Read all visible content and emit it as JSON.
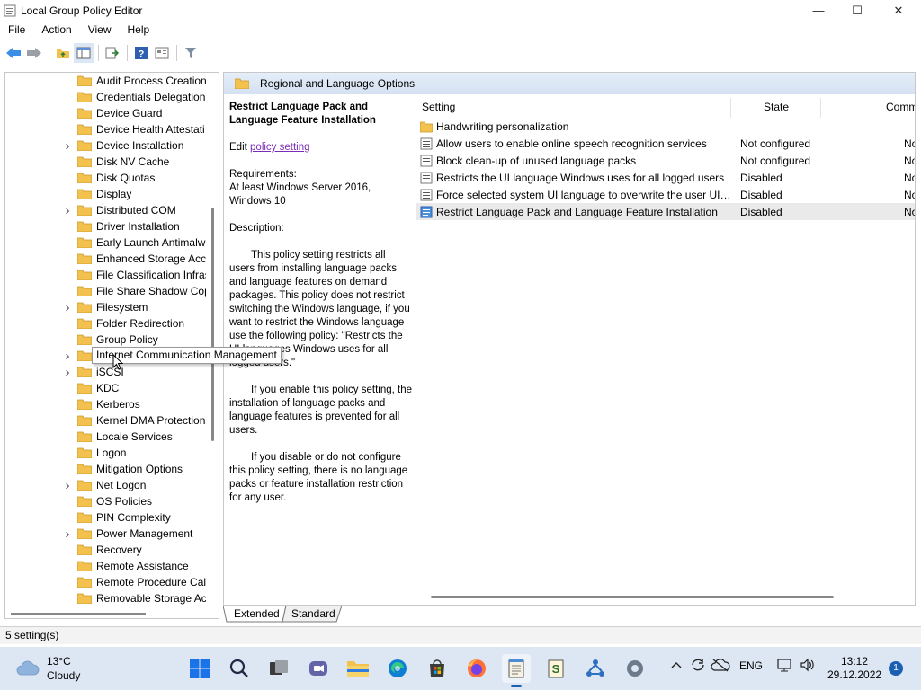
{
  "window": {
    "title": "Local Group Policy Editor",
    "controls": {
      "minimize": "—",
      "maximize": "☐",
      "close": "✕"
    }
  },
  "menu": [
    "File",
    "Action",
    "View",
    "Help"
  ],
  "tree": {
    "items": [
      {
        "label": "Audit Process Creation",
        "expandable": false
      },
      {
        "label": "Credentials Delegation",
        "expandable": false
      },
      {
        "label": "Device Guard",
        "expandable": false
      },
      {
        "label": "Device Health Attestati",
        "expandable": false
      },
      {
        "label": "Device Installation",
        "expandable": true
      },
      {
        "label": "Disk NV Cache",
        "expandable": false
      },
      {
        "label": "Disk Quotas",
        "expandable": false
      },
      {
        "label": "Display",
        "expandable": false
      },
      {
        "label": "Distributed COM",
        "expandable": true
      },
      {
        "label": "Driver Installation",
        "expandable": false
      },
      {
        "label": "Early Launch Antimalw",
        "expandable": false
      },
      {
        "label": "Enhanced Storage Acce",
        "expandable": false
      },
      {
        "label": "File Classification Infras",
        "expandable": false
      },
      {
        "label": "File Share Shadow Cop",
        "expandable": false
      },
      {
        "label": "Filesystem",
        "expandable": true
      },
      {
        "label": "Folder Redirection",
        "expandable": false
      },
      {
        "label": "Group Policy",
        "expandable": false
      },
      {
        "label": "Internet Communication Management",
        "expandable": true
      },
      {
        "label": "iSCSI",
        "expandable": true
      },
      {
        "label": "KDC",
        "expandable": false
      },
      {
        "label": "Kerberos",
        "expandable": false
      },
      {
        "label": "Kernel DMA Protection",
        "expandable": false
      },
      {
        "label": "Locale Services",
        "expandable": false
      },
      {
        "label": "Logon",
        "expandable": false
      },
      {
        "label": "Mitigation Options",
        "expandable": false
      },
      {
        "label": "Net Logon",
        "expandable": true
      },
      {
        "label": "OS Policies",
        "expandable": false
      },
      {
        "label": "PIN Complexity",
        "expandable": false
      },
      {
        "label": "Power Management",
        "expandable": true
      },
      {
        "label": "Recovery",
        "expandable": false
      },
      {
        "label": "Remote Assistance",
        "expandable": false
      },
      {
        "label": "Remote Procedure Call",
        "expandable": false
      },
      {
        "label": "Removable Storage Ac",
        "expandable": false
      }
    ],
    "tooltip": "Internet Communication Management"
  },
  "details": {
    "header": "Regional and Language Options",
    "title": "Restrict Language Pack and Language Feature Installation",
    "edit_prefix": "Edit",
    "edit_link": "policy setting",
    "requirements_label": "Requirements:",
    "requirements": "At least Windows Server 2016, Windows 10",
    "description_label": "Description:",
    "description_p1": "This policy setting restricts all users from installing language packs and language features on demand packages. This policy does not restrict switching the Windows language, if you want to restrict the Windows language use the following policy: \"Restricts the UI languages Windows uses for all logged users.\"",
    "description_p2": "If you enable this policy setting, the installation of language packs and language features is prevented for all users.",
    "description_p3": "If you disable or do not configure this policy setting, there is no language packs or feature installation restriction for any user."
  },
  "list": {
    "columns": {
      "setting": "Setting",
      "state": "State",
      "comment": "Comm"
    },
    "rows": [
      {
        "name": "Handwriting personalization",
        "state": "",
        "comment": "",
        "type": "folder"
      },
      {
        "name": "Allow users to enable online speech recognition services",
        "state": "Not configured",
        "comment": "No",
        "type": "setting"
      },
      {
        "name": "Block clean-up of unused language packs",
        "state": "Not configured",
        "comment": "No",
        "type": "setting"
      },
      {
        "name": "Restricts the UI language Windows uses for all logged users",
        "state": "Disabled",
        "comment": "No",
        "type": "setting"
      },
      {
        "name": "Force selected system UI language to overwrite the user UI l...",
        "state": "Disabled",
        "comment": "No",
        "type": "setting"
      },
      {
        "name": "Restrict Language Pack and Language Feature Installation",
        "state": "Disabled",
        "comment": "No",
        "type": "setting-selected"
      }
    ]
  },
  "tabs": [
    "Extended",
    "Standard"
  ],
  "status": "5 setting(s)",
  "taskbar": {
    "weather_temp": "13°C",
    "weather_cond": "Cloudy",
    "language": "ENG",
    "time": "13:12",
    "date": "29.12.2022",
    "notifications": "1",
    "icons": [
      "windows-start-icon",
      "search-icon",
      "task-view-icon",
      "chat-icon",
      "file-explorer-icon",
      "edge-icon",
      "store-icon",
      "firefox-icon",
      "notepad-icon",
      "script-icon",
      "network-tool-icon",
      "settings-icon"
    ]
  },
  "colors": {
    "accent": "#1a5fb4",
    "folder": "#f2c14e",
    "link": "#7b2cb5",
    "taskbar": "#dde6f3"
  }
}
